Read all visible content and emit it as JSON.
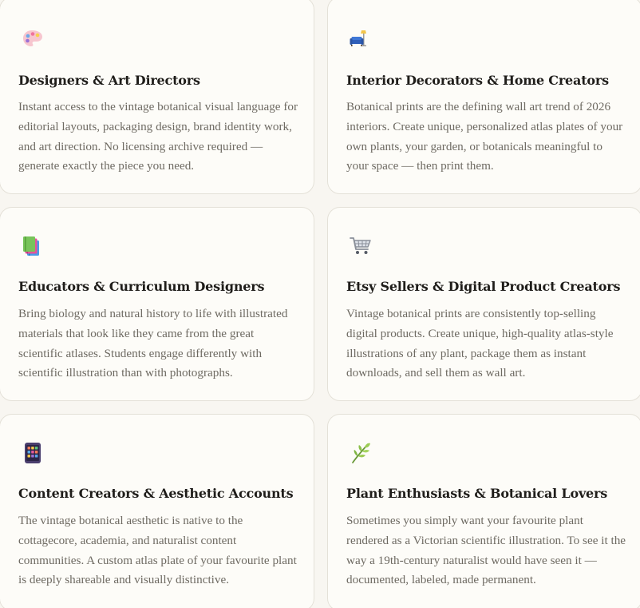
{
  "cards": [
    {
      "icon": "artist-palette-icon",
      "title": "Designers & Art Directors",
      "description": "Instant access to the vintage botanical visual language for editorial layouts, packaging design, brand identity work, and art direction. No licensing archive required — generate exactly the piece you need."
    },
    {
      "icon": "couch-and-lamp-icon",
      "title": "Interior Decorators & Home Creators",
      "description": "Botanical prints are the defining wall art trend of 2026 interiors. Create unique, personalized atlas plates of your own plants, your garden, or botanicals meaningful to your space — then print them."
    },
    {
      "icon": "books-icon",
      "title": "Educators & Curriculum Designers",
      "description": "Bring biology and natural history to life with illustrated materials that look like they came from the great scientific atlases. Students engage differently with scientific illustration than with photographs."
    },
    {
      "icon": "shopping-cart-icon",
      "title": "Etsy Sellers & Digital Product Creators",
      "description": "Vintage botanical prints are consistently top-selling digital products. Create unique, high-quality atlas-style illustrations of any plant, package them as instant downloads, and sell them as wall art."
    },
    {
      "icon": "mobile-phone-icon",
      "title": "Content Creators & Aesthetic Accounts",
      "description": "The vintage botanical aesthetic is native to the cottagecore, academia, and naturalist content communities. A custom atlas plate of your favourite plant is deeply shareable and visually distinctive."
    },
    {
      "icon": "herb-icon",
      "title": "Plant Enthusiasts & Botanical Lovers",
      "description": "Sometimes you simply want your favourite plant rendered as a Victorian scientific illustration. To see it the way a 19th-century naturalist would have seen it — documented, labeled, made permanent."
    }
  ]
}
